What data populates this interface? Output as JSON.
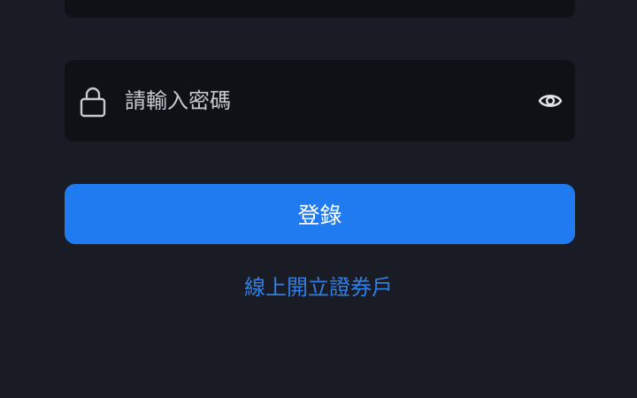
{
  "username_field": {
    "value": ""
  },
  "password_field": {
    "placeholder": "請輸入密碼",
    "value": "",
    "lock_icon": "lock-icon",
    "toggle_icon": "eye-icon"
  },
  "login_button": {
    "label": "登錄"
  },
  "open_account_link": {
    "label": "線上開立證券戶"
  },
  "colors": {
    "background": "#1a1c25",
    "field_background": "#101117",
    "primary": "#1f7bef",
    "link": "#2f7fe6",
    "icon": "#c9cad0"
  }
}
